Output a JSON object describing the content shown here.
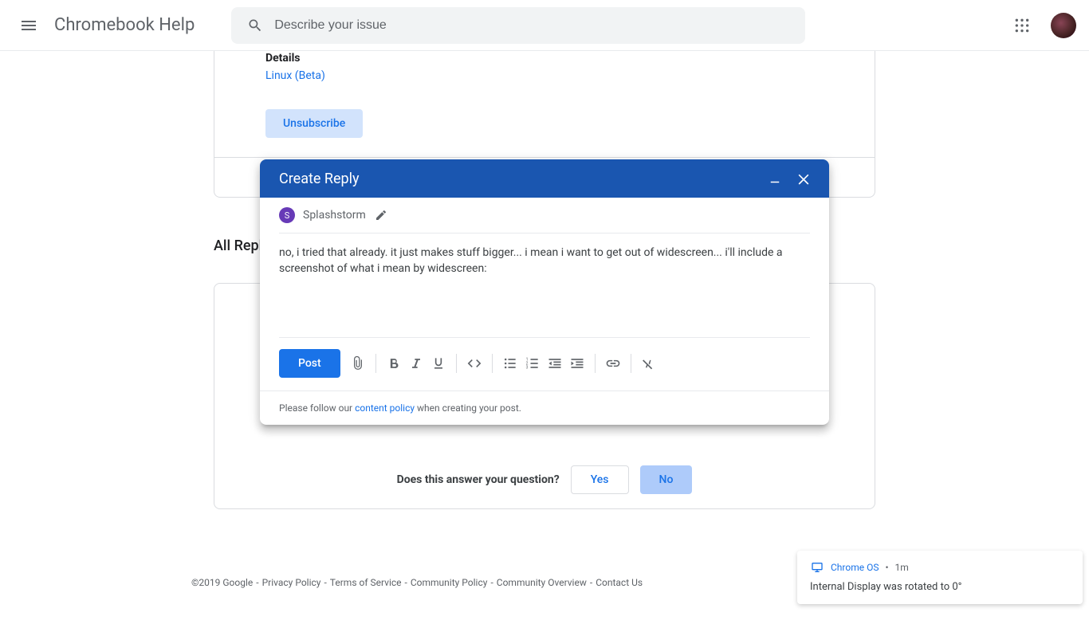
{
  "header": {
    "brand": "Chromebook Help",
    "search_placeholder": "Describe your issue"
  },
  "details": {
    "heading": "Details",
    "category_link": "Linux (Beta)",
    "unsubscribe_label": "Unsubscribe"
  },
  "replies": {
    "section_title_partial": "All Repl"
  },
  "answer": {
    "question": "Does this answer your question?",
    "yes_label": "Yes",
    "no_label": "No"
  },
  "composer": {
    "title": "Create Reply",
    "author_initial": "S",
    "author_name": "Splashstorm",
    "body_text": "no, i tried that already. it just makes stuff bigger... i mean i want to get out of widescreen... i'll include a screenshot of what i mean by widescreen:",
    "post_label": "Post",
    "policy_prefix": "Please follow our ",
    "policy_link": "content policy",
    "policy_suffix": " when creating your post."
  },
  "footer": {
    "copyright": "©2019 Google",
    "links": [
      "Privacy Policy",
      "Terms of Service",
      "Community Policy",
      "Community Overview",
      "Contact Us"
    ],
    "separator": " - "
  },
  "toast": {
    "app": "Chrome OS",
    "dot": "•",
    "time": "1m",
    "message": "Internal Display was rotated to 0°"
  }
}
